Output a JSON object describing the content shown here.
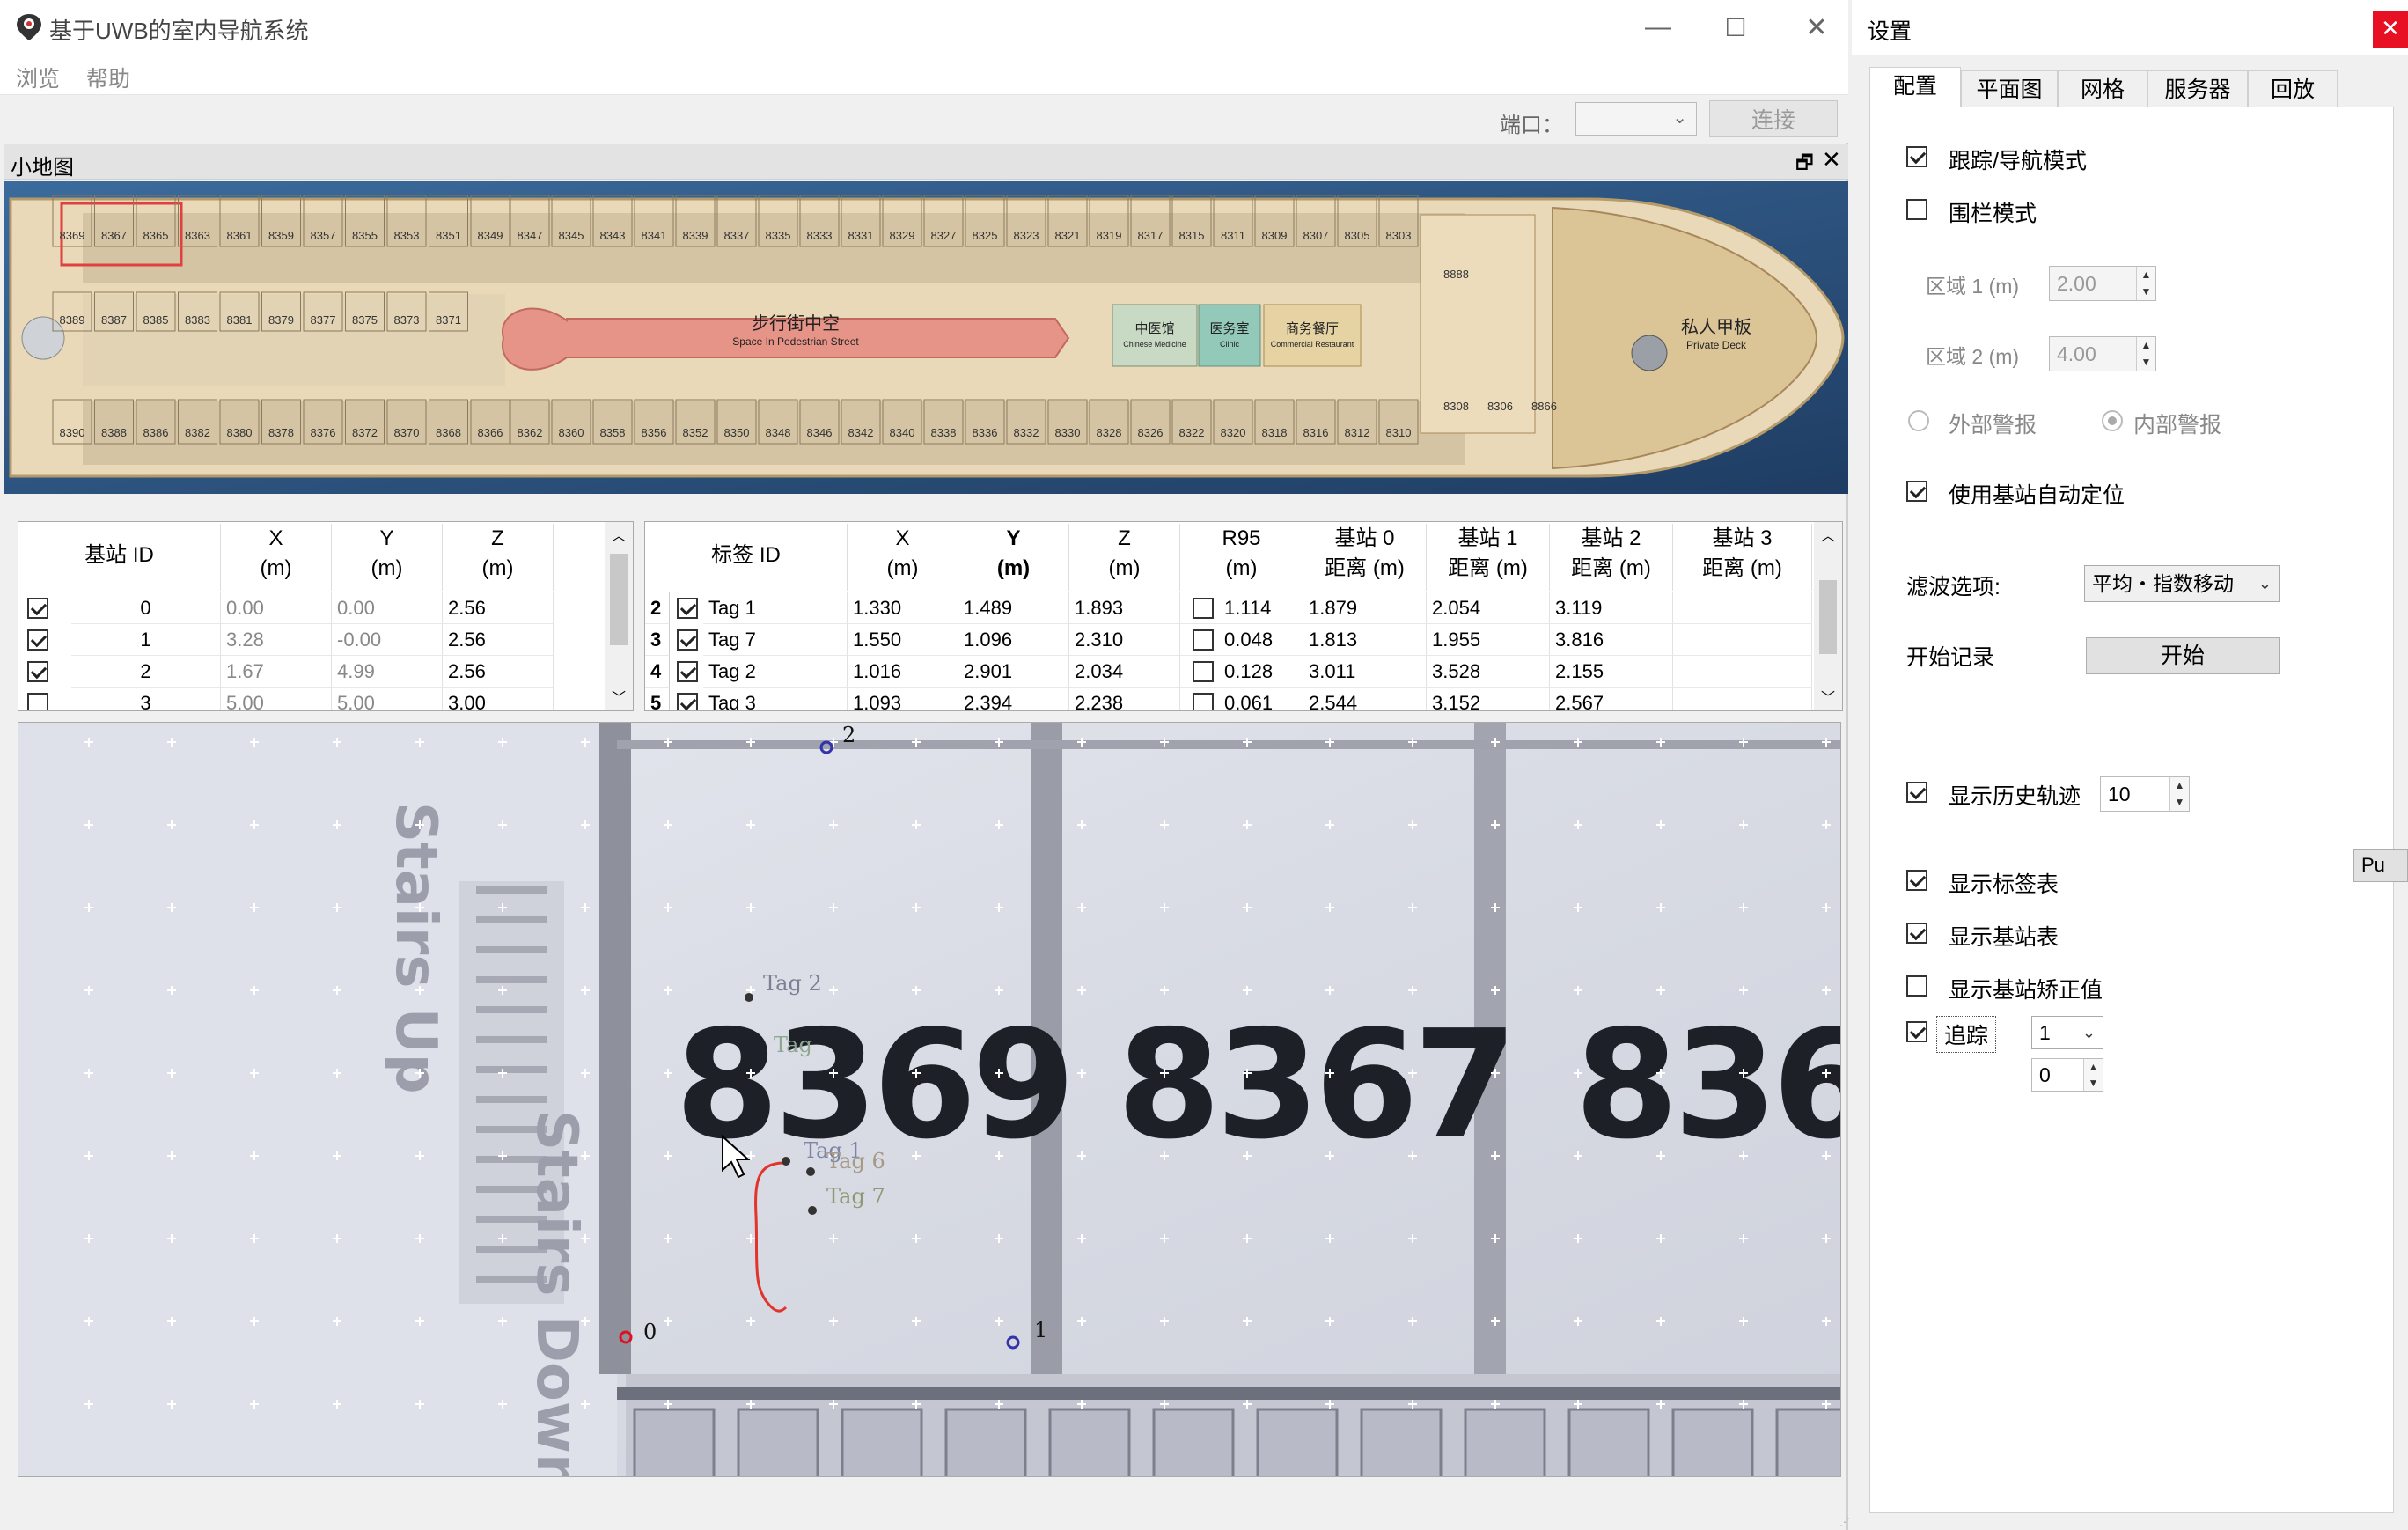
{
  "main_window": {
    "title": "基于UWB的室内导航系统",
    "window_controls": {
      "minimize": "—",
      "maximize": "☐",
      "close": "✕"
    },
    "menu": [
      "浏览",
      "帮助"
    ],
    "toolbar": {
      "port_label": "端口：",
      "port_value": "",
      "connect_label": "连接"
    },
    "minimap": {
      "title": "小地图",
      "street_label_cn": "步行街中空",
      "street_label_en": "Space In Pedestrian Street",
      "deck_label_cn": "私人甲板",
      "deck_label_en": "Private Deck",
      "room_top_left": [
        "8369",
        "8367",
        "8365",
        "8363",
        "8361",
        "8359",
        "8357",
        "8355",
        "8353",
        "8351",
        "8349"
      ],
      "room_mid_left": [
        "8389",
        "8387",
        "8385",
        "8383",
        "8381",
        "8379",
        "8377",
        "8375",
        "8373",
        "8371"
      ],
      "room_bottom_left": [
        "8390",
        "8388",
        "8386",
        "8382",
        "8380",
        "8378",
        "8376",
        "8372",
        "8370",
        "8368",
        "8366"
      ],
      "room_top_right": [
        "8347",
        "8345",
        "8343",
        "8341",
        "8339",
        "8337",
        "8335",
        "8333",
        "8331",
        "8329",
        "8327",
        "8325",
        "8323",
        "8321",
        "8319",
        "8317",
        "8315",
        "8311",
        "8309",
        "8307",
        "8305",
        "8303"
      ],
      "room_bottom_right": [
        "8362",
        "8360",
        "8358",
        "8356",
        "8352",
        "8350",
        "8348",
        "8346",
        "8342",
        "8340",
        "8338",
        "8336",
        "8332",
        "8330",
        "8328",
        "8326",
        "8322",
        "8320",
        "8318",
        "8316",
        "8312",
        "8310"
      ],
      "room_far_right": [
        "8888",
        "8308",
        "8306",
        "8866"
      ],
      "venues": [
        {
          "cn": "中医馆",
          "en": "Chinese Medicine"
        },
        {
          "cn": "医务室",
          "en": "Clinic"
        },
        {
          "cn": "商务餐厅",
          "en": "Commercial Restaurant"
        }
      ]
    }
  },
  "anchor_table": {
    "columns": [
      {
        "l1": "基站 ID",
        "l2": ""
      },
      {
        "l1": "X",
        "l2": "(m)"
      },
      {
        "l1": "Y",
        "l2": "(m)"
      },
      {
        "l1": "Z",
        "l2": "(m)"
      }
    ],
    "rows": [
      {
        "checked": true,
        "id": "0",
        "x": "0.00",
        "y": "0.00",
        "z": "2.56"
      },
      {
        "checked": true,
        "id": "1",
        "x": "3.28",
        "y": "-0.00",
        "z": "2.56"
      },
      {
        "checked": true,
        "id": "2",
        "x": "1.67",
        "y": "4.99",
        "z": "2.56"
      },
      {
        "checked": false,
        "id": "3",
        "x": "5.00",
        "y": "5.00",
        "z": "3.00"
      }
    ]
  },
  "tag_table": {
    "columns": [
      {
        "l1": "标签 ID",
        "l2": ""
      },
      {
        "l1": "X",
        "l2": "(m)"
      },
      {
        "l1": "Y",
        "l2": "(m)"
      },
      {
        "l1": "Z",
        "l2": "(m)"
      },
      {
        "l1": "R95",
        "l2": "(m)"
      },
      {
        "l1": "基站 0",
        "l2": "距离 (m)"
      },
      {
        "l1": "基站 1",
        "l2": "距离 (m)"
      },
      {
        "l1": "基站 2",
        "l2": "距离 (m)"
      },
      {
        "l1": "基站 3",
        "l2": "距离 (m)"
      }
    ],
    "rows": [
      {
        "num": "2",
        "checked": true,
        "tag": "Tag 1",
        "x": "1.330",
        "y": "1.489",
        "z": "1.893",
        "r95_checked": false,
        "r95": "1.114",
        "d0": "1.879",
        "d1": "2.054",
        "d2": "3.119",
        "d3": ""
      },
      {
        "num": "3",
        "checked": true,
        "tag": "Tag 7",
        "x": "1.550",
        "y": "1.096",
        "z": "2.310",
        "r95_checked": false,
        "r95": "0.048",
        "d0": "1.813",
        "d1": "1.955",
        "d2": "3.816",
        "d3": ""
      },
      {
        "num": "4",
        "checked": true,
        "tag": "Tag 2",
        "x": "1.016",
        "y": "2.901",
        "z": "2.034",
        "r95_checked": false,
        "r95": "0.128",
        "d0": "3.011",
        "d1": "3.528",
        "d2": "2.155",
        "d3": ""
      },
      {
        "num": "5",
        "checked": true,
        "tag": "Tag 3",
        "x": "1.093",
        "y": "2.394",
        "z": "2.238",
        "r95_checked": false,
        "r95": "0.061",
        "d0": "2.544",
        "d1": "3.152",
        "d2": "2.567",
        "d3": ""
      }
    ]
  },
  "main_map": {
    "room_numbers": [
      "8369",
      "8367",
      "836"
    ],
    "stairs_up": "Stairs Up",
    "stairs_down": "Stairs Down",
    "anchors": [
      "0",
      "1",
      "2"
    ],
    "tags": [
      "Tag 2",
      "Tag",
      "Tag 1",
      "Tag 6",
      "Tag 7"
    ]
  },
  "settings": {
    "title": "设置",
    "close": "✕",
    "tabs": [
      "配置",
      "平面图",
      "网格",
      "服务器",
      "回放"
    ],
    "tracking_mode": {
      "label": "跟踪/导航模式",
      "checked": true
    },
    "fence_mode": {
      "label": "围栏模式",
      "checked": false
    },
    "zone1": {
      "label": "区域 1 (m)",
      "value": "2.00"
    },
    "zone2": {
      "label": "区域 2 (m)",
      "value": "4.00"
    },
    "outer_alarm": "外部警报",
    "inner_alarm": "内部警报",
    "auto_position": {
      "label": "使用基站自动定位",
      "checked": true
    },
    "filter": {
      "label": "滤波选项:",
      "value": "平均・指数移动"
    },
    "record": {
      "label": "开始记录",
      "button": "开始"
    },
    "history": {
      "label": "显示历史轨迹",
      "checked": true,
      "value": "10"
    },
    "push_button": "Pu",
    "show_tag_table": {
      "label": "显示标签表",
      "checked": true
    },
    "show_anchor_table": {
      "label": "显示基站表",
      "checked": true
    },
    "show_anchor_correction": {
      "label": "显示基站矫正值",
      "checked": false
    },
    "track": {
      "label": "追踪",
      "checked": true,
      "select_value": "1",
      "spin_value": "0"
    }
  }
}
